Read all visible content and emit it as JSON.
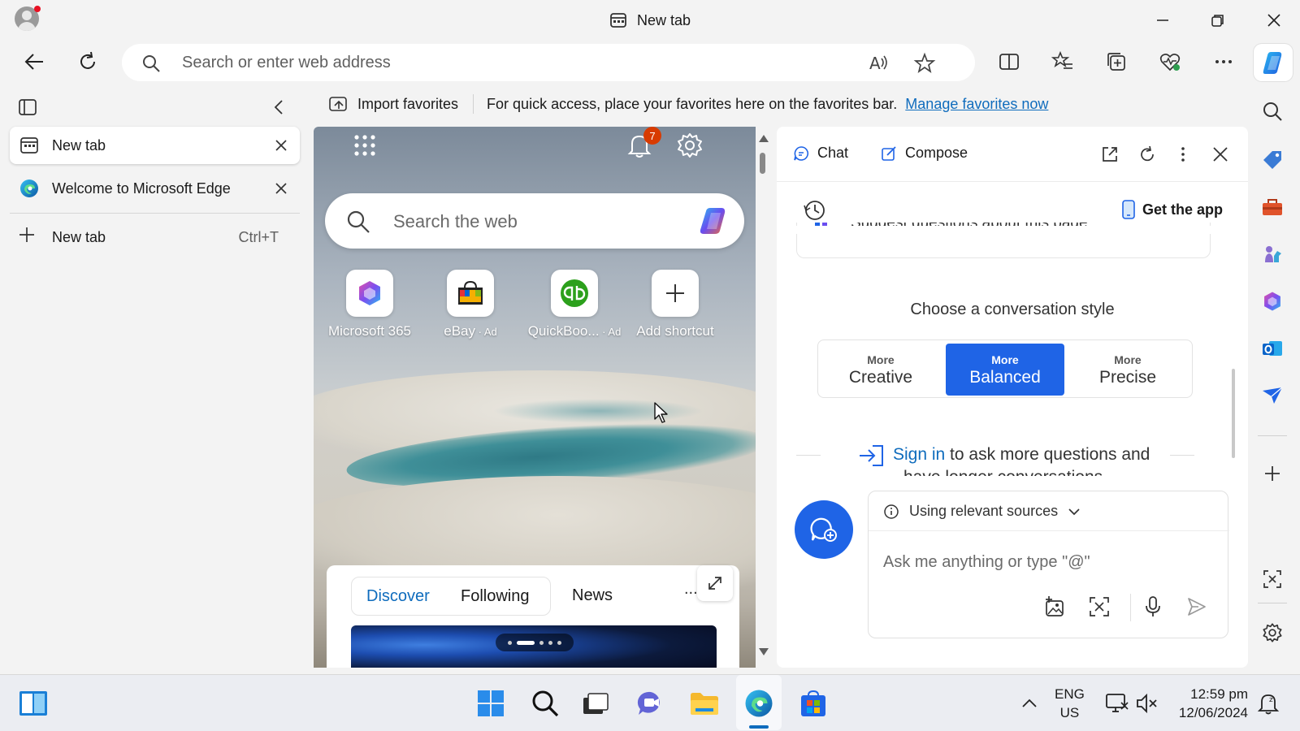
{
  "window": {
    "title": "New tab"
  },
  "toolbar": {
    "address_placeholder": "Search or enter web address"
  },
  "favorites_bar": {
    "import_label": "Import favorites",
    "message": "For quick access, place your favorites here on the favorites bar.",
    "manage_link": "Manage favorites now"
  },
  "vertical_tabs": {
    "tabs": [
      {
        "label": "New tab",
        "icon": "new-tab-page-icon",
        "active": true
      },
      {
        "label": "Welcome to Microsoft Edge",
        "icon": "edge-logo-icon",
        "active": false
      }
    ],
    "new_tab_label": "New tab",
    "new_tab_shortcut": "Ctrl+T"
  },
  "new_tab_page": {
    "notification_count": "7",
    "search_placeholder": "Search the web",
    "shortcuts": [
      {
        "label": "Microsoft 365",
        "ad": ""
      },
      {
        "label": "eBay",
        "ad": " · Ad"
      },
      {
        "label": "QuickBoo...",
        "ad": " · Ad"
      },
      {
        "label": "Add shortcut",
        "ad": ""
      }
    ],
    "feed": {
      "tabs": [
        "Discover",
        "Following",
        "News"
      ],
      "more": "..."
    }
  },
  "copilot_pane": {
    "tabs": {
      "chat": "Chat",
      "compose": "Compose"
    },
    "get_app": "Get the app",
    "suggest": "Suggest questions about this page",
    "style_title": "Choose a conversation style",
    "styles": [
      {
        "small": "More",
        "big": "Creative",
        "selected": false
      },
      {
        "small": "More",
        "big": "Balanced",
        "selected": true
      },
      {
        "small": "More",
        "big": "Precise",
        "selected": false
      }
    ],
    "signin_link": "Sign in",
    "signin_text": " to ask more questions and",
    "signin_text2": "have longer conversations",
    "sources_label": "Using relevant sources",
    "ask_placeholder": "Ask me anything or type \"@\""
  },
  "taskbar": {
    "lang_line1": "ENG",
    "lang_line2": "US",
    "time": "12:59 pm",
    "date": "12/06/2024"
  },
  "colors": {
    "accent": "#0f6cbd",
    "copilot_blue": "#1f64e6",
    "badge": "#d83b01"
  }
}
